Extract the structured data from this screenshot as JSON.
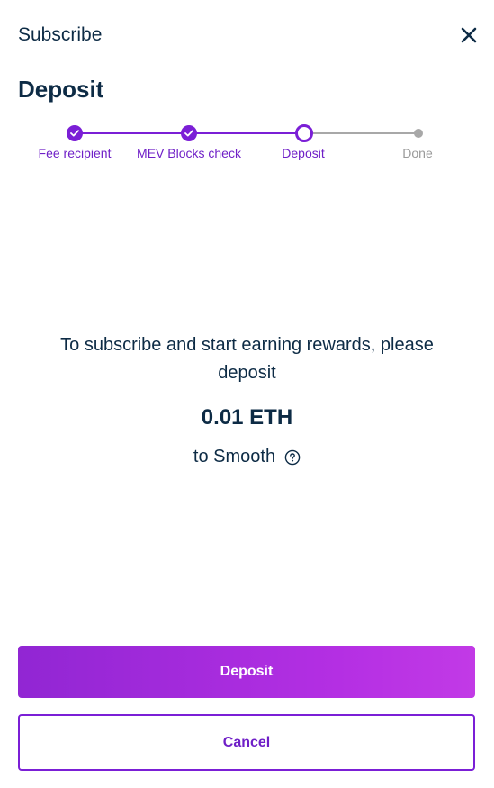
{
  "header": {
    "title": "Subscribe",
    "close_icon": "close-icon"
  },
  "page_title": "Deposit",
  "stepper": {
    "steps": [
      {
        "label": "Fee recipient",
        "status": "completed"
      },
      {
        "label": "MEV Blocks check",
        "status": "completed"
      },
      {
        "label": "Deposit",
        "status": "current"
      },
      {
        "label": "Done",
        "status": "pending"
      }
    ]
  },
  "content": {
    "intro": "To subscribe and start earning rewards, please deposit",
    "amount": "0.01 ETH",
    "destination": "to Smooth",
    "help_icon": "help-circle-icon"
  },
  "actions": {
    "deposit_label": "Deposit",
    "cancel_label": "Cancel"
  },
  "colors": {
    "accent": "#7b1fd6",
    "text": "#0d2b45",
    "pending": "#a8a8a8",
    "gradient_start": "#9126d3",
    "gradient_end": "#c23ae6"
  }
}
